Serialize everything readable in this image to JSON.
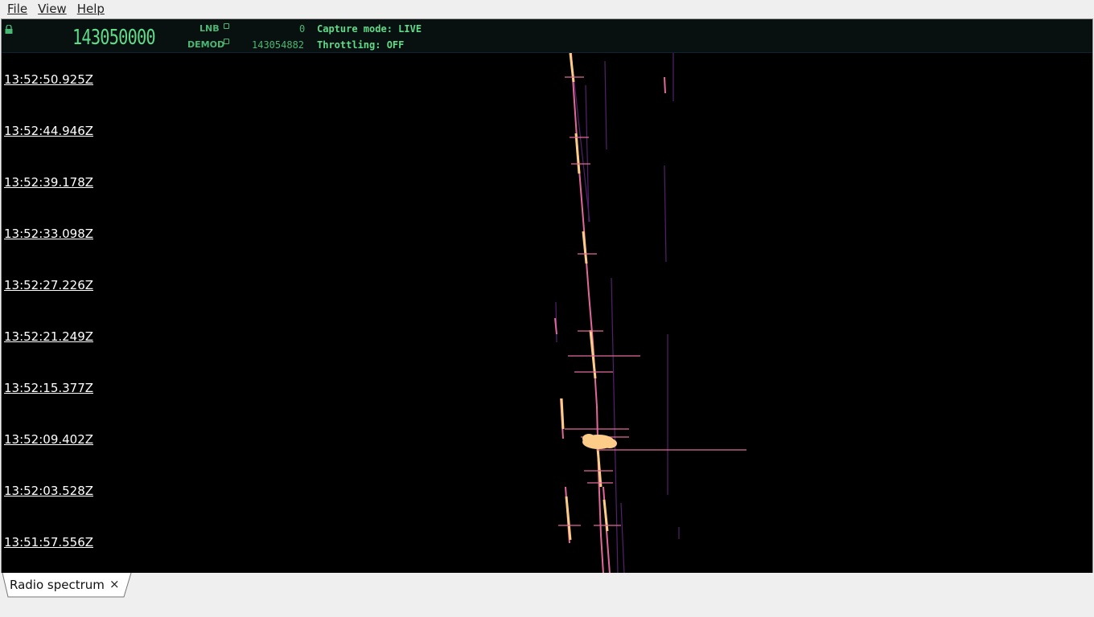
{
  "menu": {
    "items": [
      "File",
      "View",
      "Help"
    ]
  },
  "header": {
    "frequency_main": "143050000",
    "lnb_label": "LNB",
    "lnb_value": "0",
    "demod_label": "DEMOD",
    "demod_value": "143054882",
    "capture_mode": "Capture mode: LIVE",
    "throttling": "Throttling: OFF"
  },
  "waterfall": {
    "timestamps": [
      "13:52:50.925Z",
      "13:52:44.946Z",
      "13:52:39.178Z",
      "13:52:33.098Z",
      "13:52:27.226Z",
      "13:52:21.249Z",
      "13:52:15.377Z",
      "13:52:09.402Z",
      "13:52:03.528Z",
      "13:51:57.556Z"
    ],
    "colors": {
      "background": "#000000",
      "hot": "#fccc88",
      "mid": "#e0689a",
      "low": "#6a2a8a"
    }
  },
  "tabs": [
    {
      "label": "Radio spectrum",
      "close": "×"
    }
  ]
}
